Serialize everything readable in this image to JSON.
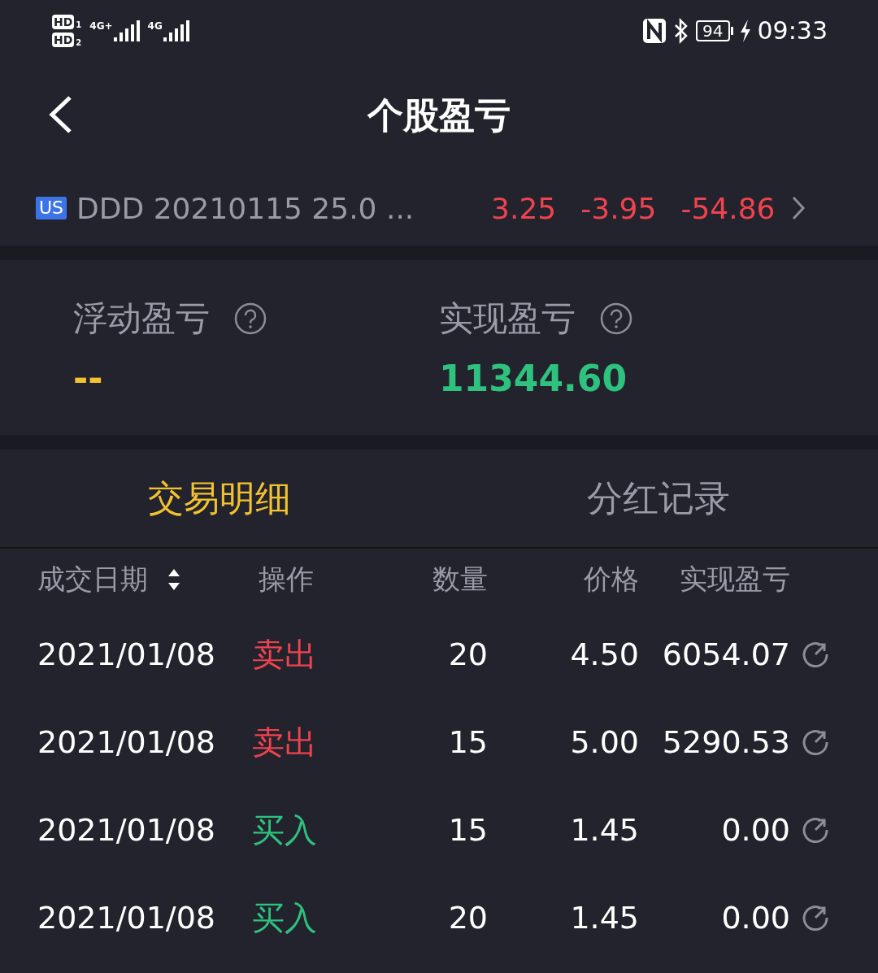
{
  "status_bar": {
    "sims": [
      {
        "badge": "HD",
        "slot": "1",
        "network": "4G+"
      },
      {
        "badge": "HD",
        "slot": "2",
        "network": "4G"
      }
    ],
    "battery": "94",
    "time": "09:33"
  },
  "header": {
    "title": "个股盈亏"
  },
  "position": {
    "market": "US",
    "name": "DDD 20210115 25.0 ...",
    "values": [
      "3.25",
      "-3.95",
      "-54.86"
    ]
  },
  "summary": [
    {
      "label": "浮动盈亏",
      "value": "--",
      "color": "#f2c230"
    },
    {
      "label": "实现盈亏",
      "value": "11344.60",
      "color": "#2ec27e"
    }
  ],
  "tabs": [
    {
      "label": "交易明细",
      "selected": true
    },
    {
      "label": "分红记录",
      "selected": false
    }
  ],
  "table": {
    "columns": [
      {
        "label": "成交日期",
        "sortable": true
      },
      {
        "label": "操作",
        "sortable": false
      },
      {
        "label": "数量",
        "sortable": false
      },
      {
        "label": "价格",
        "sortable": false
      },
      {
        "label": "实现盈亏",
        "sortable": false
      }
    ],
    "rows": [
      {
        "date": "2021/01/08",
        "action": "卖出",
        "kind": "sell",
        "quantity": "20",
        "price": "4.50",
        "pnl": "6054.07"
      },
      {
        "date": "2021/01/08",
        "action": "卖出",
        "kind": "sell",
        "quantity": "15",
        "price": "5.00",
        "pnl": "5290.53"
      },
      {
        "date": "2021/01/08",
        "action": "买入",
        "kind": "buy",
        "quantity": "15",
        "price": "1.45",
        "pnl": "0.00"
      },
      {
        "date": "2021/01/08",
        "action": "买入",
        "kind": "buy",
        "quantity": "20",
        "price": "1.45",
        "pnl": "0.00"
      }
    ]
  }
}
